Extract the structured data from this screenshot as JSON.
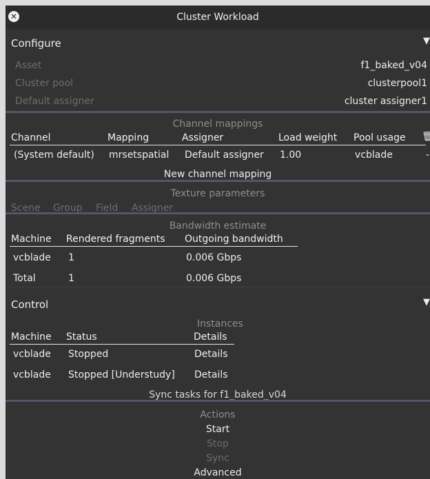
{
  "window": {
    "title": "Cluster Workload"
  },
  "configure": {
    "header": "Configure",
    "rows": [
      {
        "label": "Asset",
        "value": "f1_baked_v04"
      },
      {
        "label": "Cluster pool",
        "value": "clusterpool1"
      },
      {
        "label": "Default assigner",
        "value": "cluster assigner1"
      }
    ]
  },
  "channel_mappings": {
    "title": "Channel mappings",
    "columns": [
      "Channel",
      "Mapping",
      "Assigner",
      "Load weight",
      "Pool usage"
    ],
    "rows": [
      {
        "channel": "(System default)",
        "mapping": "mrsetspatial",
        "assigner": "Default assigner",
        "load_weight": "1.00",
        "pool_usage": "vcblade",
        "extra": "-"
      }
    ],
    "new_button": "New channel mapping"
  },
  "texture_parameters": {
    "title": "Texture parameters",
    "columns": [
      "Scene",
      "Group",
      "Field",
      "Assigner"
    ]
  },
  "bandwidth": {
    "title": "Bandwidth estimate",
    "columns": [
      "Machine",
      "Rendered fragments",
      "Outgoing bandwidth"
    ],
    "rows": [
      {
        "machine": "vcblade",
        "fragments": "1",
        "bandwidth": "0.006 Gbps"
      },
      {
        "machine": "Total",
        "fragments": "1",
        "bandwidth": "0.006 Gbps"
      }
    ]
  },
  "control": {
    "header": "Control",
    "instances_title": "Instances",
    "columns": [
      "Machine",
      "Status",
      "Details"
    ],
    "rows": [
      {
        "machine": "vcblade",
        "status": "Stopped",
        "details": "Details"
      },
      {
        "machine": "vcblade",
        "status": "Stopped [Understudy]",
        "details": "Details"
      }
    ],
    "sync_tasks": "Sync tasks for f1_baked_v04"
  },
  "actions": {
    "title": "Actions",
    "start": "Start",
    "stop": "Stop",
    "sync": "Sync",
    "advanced": "Advanced"
  }
}
